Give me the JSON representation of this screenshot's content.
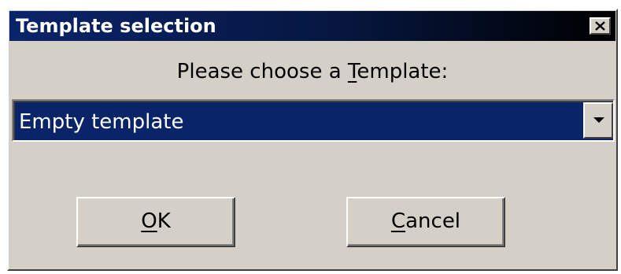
{
  "dialog": {
    "title": "Template selection",
    "prompt": {
      "before": "Please choose a ",
      "mnemonic": "T",
      "after": "emplate:"
    },
    "combo": {
      "selected_value": "Empty template"
    },
    "buttons": {
      "ok": {
        "mnemonic": "O",
        "rest": "K"
      },
      "cancel": {
        "mnemonic": "C",
        "rest": "ancel"
      }
    }
  },
  "colors": {
    "face": "#d4d0c8",
    "title_gradient_start": "#0a246a",
    "title_gradient_end": "#000000",
    "selection": "#0a246a"
  },
  "icons": {
    "close": "close-icon",
    "dropdown": "chevron-down-icon"
  }
}
